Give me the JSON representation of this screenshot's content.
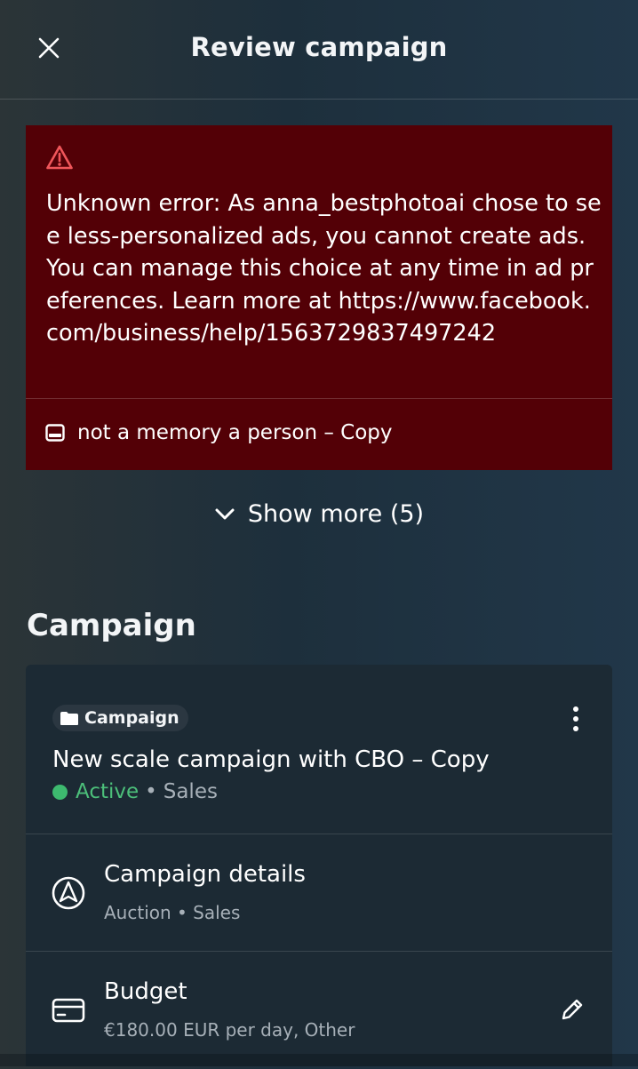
{
  "header": {
    "title": "Review campaign",
    "close_icon": "close-icon"
  },
  "error": {
    "icon": "warning-triangle-icon",
    "message": "Unknown error: As anna_bestphotoai chose to see less-personalized ads, you cannot create ads. You can manage this choice at any time in ad preferences. Learn more at https://www.facebook.com/business/help/1563729837497242",
    "ad_icon": "ad-icon",
    "ad_name": "not a memory a person – Copy",
    "color": "#530006"
  },
  "show_more": {
    "label": "Show more (5)",
    "icon": "chevron-down-icon"
  },
  "campaign_section": {
    "title": "Campaign",
    "chip_icon": "folder-icon",
    "chip_label": "Campaign",
    "menu_icon": "more-vertical-icon",
    "name": "New scale campaign with CBO – Copy",
    "status": "Active",
    "separator": "•",
    "objective": "Sales",
    "status_color": "#3dba6f",
    "details": {
      "icon": "navigation-icon",
      "title": "Campaign details",
      "subtitle": "Auction • Sales"
    },
    "budget": {
      "icon": "credit-card-icon",
      "title": "Budget",
      "subtitle": "€180.00 EUR per day, Other",
      "edit_icon": "pencil-icon"
    }
  }
}
